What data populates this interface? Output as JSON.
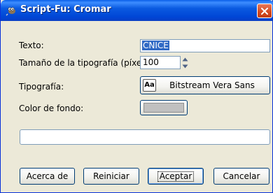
{
  "window": {
    "title": "Script-Fu: Cromar",
    "title_icon": "gimp-wilber-icon",
    "close_icon": "close-x-icon"
  },
  "form": {
    "text_label": "Texto:",
    "text_value": "CNICE",
    "font_size_label": "Tamaño de la tipografía (píxeles):",
    "font_size_value": "100",
    "font_label": "Tipografía:",
    "font_icon_glyph": "Aa",
    "font_value": "Bitstream Vera Sans",
    "bg_color_label": "Color de fondo:",
    "bg_color": "#c0c0c0"
  },
  "buttons": {
    "about": "Acerca de",
    "reset": "Reiniciar",
    "accept": "Aceptar",
    "cancel": "Cancelar"
  },
  "colors": {
    "titlebar": "#0a5ae0",
    "window_bg": "#ece9d8",
    "close": "#d4491f"
  }
}
